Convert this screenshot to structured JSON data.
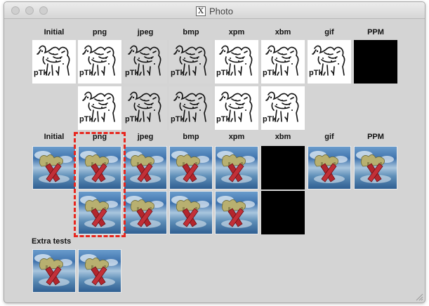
{
  "window": {
    "title": "Photo",
    "app_icon": "x11-icon"
  },
  "section1": {
    "headers": [
      "Initial",
      "png",
      "jpeg",
      "bmp",
      "xpm",
      "xbm",
      "gif",
      "PPM"
    ],
    "row1": [
      "white",
      "white",
      "gray",
      "gray",
      "white",
      "white",
      "white",
      "black"
    ],
    "row2": [
      "",
      "white",
      "gray",
      "gray",
      "white",
      "white",
      "",
      ""
    ],
    "image_caption": "pTk"
  },
  "section2": {
    "headers": [
      "Initial",
      "png",
      "jpeg",
      "bmp",
      "xpm",
      "xbm",
      "gif",
      "PPM"
    ],
    "row1": [
      "sky",
      "sky",
      "sky",
      "sky",
      "sky",
      "black",
      "sky",
      "sky"
    ],
    "row2": [
      "",
      "sky",
      "sky",
      "sky",
      "sky",
      "black",
      "",
      ""
    ],
    "selected_column": "png"
  },
  "extra": {
    "label": "Extra tests",
    "images": [
      "sky",
      "sky"
    ]
  },
  "colors": {
    "selection": "#e8261e",
    "window_bg": "#d4d4d4"
  }
}
